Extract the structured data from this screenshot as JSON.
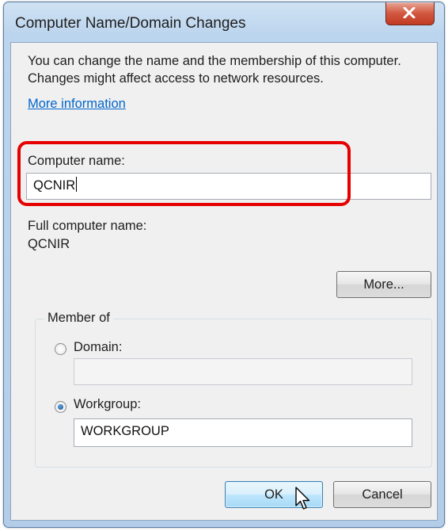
{
  "window": {
    "title": "Computer Name/Domain Changes"
  },
  "intro": {
    "text": "You can change the name and the membership of this computer. Changes might affect access to network resources.",
    "link": "More information"
  },
  "computer_name": {
    "label": "Computer name:",
    "value": "QCNIR"
  },
  "full_name": {
    "label": "Full computer name:",
    "value": "QCNIR"
  },
  "buttons": {
    "more": "More...",
    "ok": "OK",
    "cancel": "Cancel"
  },
  "member_of": {
    "legend": "Member of",
    "domain_label": "Domain:",
    "domain_value": "",
    "workgroup_label": "Workgroup:",
    "workgroup_value": "WORKGROUP",
    "selected": "Workgroup"
  },
  "colors": {
    "highlight": "#e60000",
    "link": "#0066cc",
    "close_button": "#c9442c"
  }
}
